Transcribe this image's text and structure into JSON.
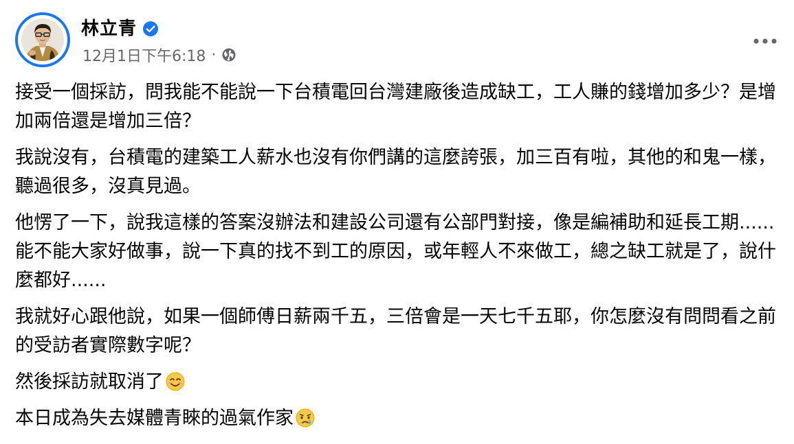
{
  "post": {
    "author": {
      "name": "林立青",
      "verified": true,
      "avatar_icon": "portrait-avatar"
    },
    "timestamp": "12月1日下午6:18",
    "separator": "·",
    "audience_icon": "globe-icon",
    "more_icon": "ellipsis-icon",
    "paragraphs": [
      "接受一個採訪，問我能不能說一下台積電回台灣建廠後造成缺工，工人賺的錢增加多少？是增加兩倍還是增加三倍？",
      "我說沒有，台積電的建築工人薪水也沒有你們講的這麼誇張，加三百有啦，其他的和鬼一樣，聽過很多，沒真見過。",
      "他愣了一下，說我這樣的答案沒辦法和建設公司還有公部門對接，像是編補助和延長工期......能不能大家好做事，說一下真的找不到工的原因，或年輕人不來做工，總之缺工就是了，說什麼都好......",
      "我就好心跟他說，如果一個師傅日薪兩千五，三倍會是一天七千五耶，你怎麼沒有問問看之前的受訪者實際數字呢？",
      "然後採訪就取消了",
      "本日成為失去媒體青睞的過氣作家"
    ],
    "emojis": {
      "p5": "smiling-face-emoji",
      "p6": "crying-face-emoji"
    }
  },
  "colors": {
    "accent": "#1877f2",
    "meta_text": "#65676b",
    "body_text": "#050505"
  }
}
